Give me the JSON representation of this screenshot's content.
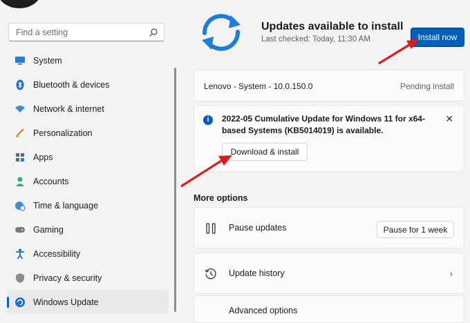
{
  "search": {
    "placeholder": "Find a setting"
  },
  "sidebar": {
    "items": [
      {
        "label": "System",
        "icon": "monitor-icon"
      },
      {
        "label": "Bluetooth & devices",
        "icon": "bluetooth-icon"
      },
      {
        "label": "Network & internet",
        "icon": "wifi-icon"
      },
      {
        "label": "Personalization",
        "icon": "brush-icon"
      },
      {
        "label": "Apps",
        "icon": "apps-icon"
      },
      {
        "label": "Accounts",
        "icon": "person-icon"
      },
      {
        "label": "Time & language",
        "icon": "globe-clock-icon"
      },
      {
        "label": "Gaming",
        "icon": "gamepad-icon"
      },
      {
        "label": "Accessibility",
        "icon": "accessibility-icon"
      },
      {
        "label": "Privacy & security",
        "icon": "shield-icon"
      },
      {
        "label": "Windows Update",
        "icon": "update-icon",
        "active": true
      }
    ]
  },
  "header": {
    "title": "Updates available to install",
    "subtitle": "Last checked: Today, 11:30 AM",
    "install_label": "Install now"
  },
  "updates": [
    {
      "name": "Lenovo - System - 10.0.150.0",
      "status": "Pending install"
    }
  ],
  "notice": {
    "message": "2022-05 Cumulative Update for Windows 11 for x64-based Systems (KB5014019) is available.",
    "button_label": "Download & install",
    "close_glyph": "✕"
  },
  "more_options": {
    "heading": "More options",
    "pause": {
      "label": "Pause updates",
      "button": "Pause for 1 week"
    },
    "history": {
      "label": "Update history"
    },
    "advanced": {
      "label": "Advanced options"
    }
  },
  "colors": {
    "accent": "#005fb8",
    "annotation_arrow": "#e01b1b"
  }
}
